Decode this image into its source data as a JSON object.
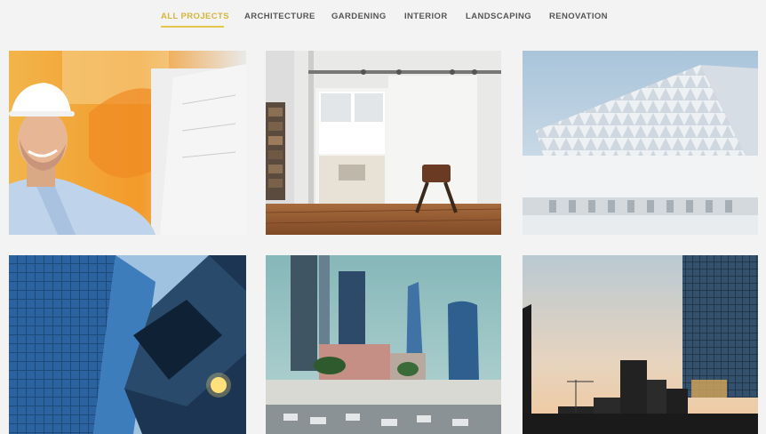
{
  "filters": [
    {
      "label": "ALL PROJECTS",
      "active": true
    },
    {
      "label": "ARCHITECTURE",
      "active": false
    },
    {
      "label": "GARDENING",
      "active": false
    },
    {
      "label": "INTERIOR",
      "active": false
    },
    {
      "label": "LANDSCAPING",
      "active": false
    },
    {
      "label": "RENOVATION",
      "active": false
    }
  ],
  "colors": {
    "accent": "#e3c64a",
    "background": "#f3f3f3",
    "filter_text": "#555555"
  }
}
